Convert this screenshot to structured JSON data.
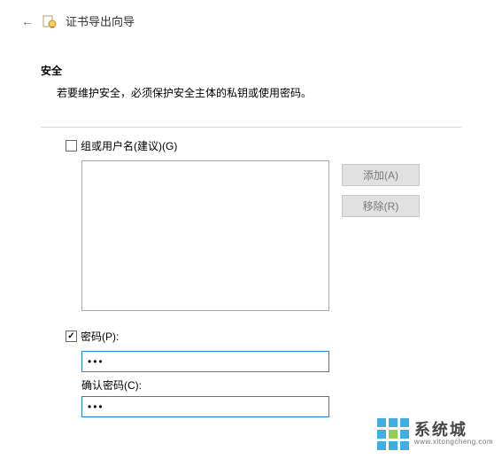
{
  "titlebar": {
    "title": "证书导出向导"
  },
  "section": {
    "heading": "安全",
    "desc": "若要维护安全，必须保护安全主体的私钥或使用密码。"
  },
  "group": {
    "checkbox_label": "组或用户名(建议)(G)"
  },
  "buttons": {
    "add": "添加(A)",
    "remove": "移除(R)"
  },
  "password": {
    "checkbox_label": "密码(P):",
    "value": "•••",
    "confirm_label": "确认密码(C):",
    "confirm_value": "•••"
  },
  "watermark": {
    "cn": "系统城",
    "en": "www.xitongcheng.com"
  }
}
